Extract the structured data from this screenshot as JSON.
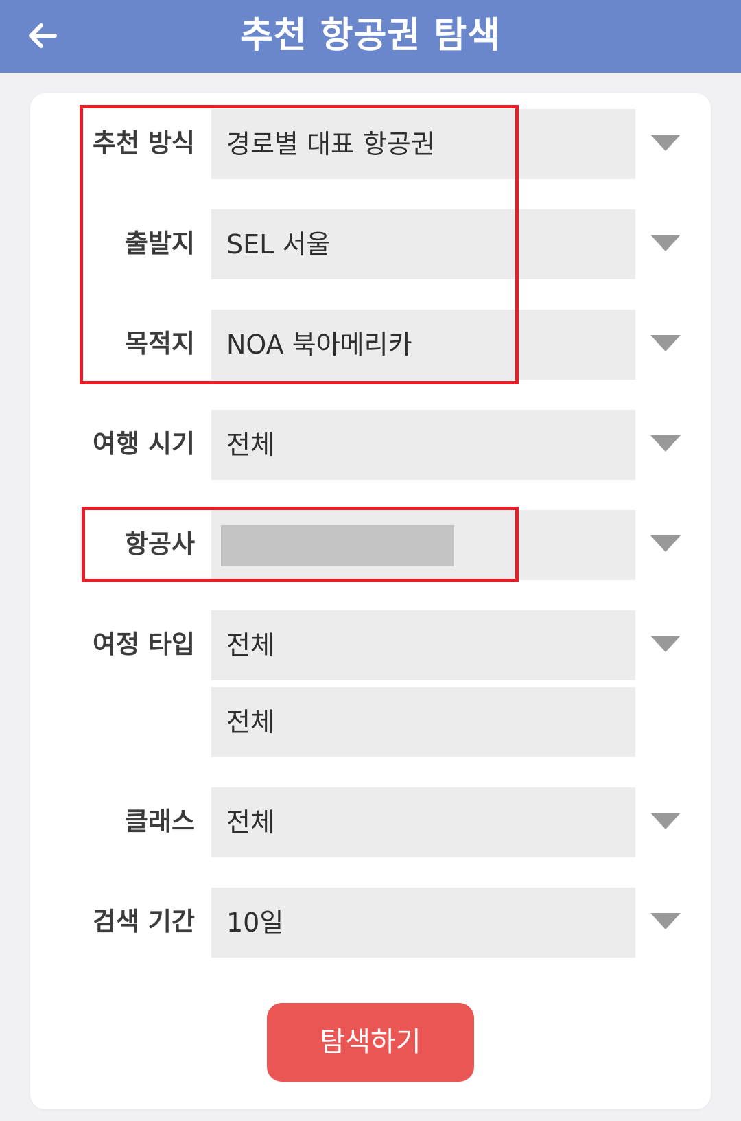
{
  "header": {
    "title": "추천 항공권 탐색",
    "back_icon": "arrow-left-icon"
  },
  "form": {
    "recommend_method": {
      "label": "추천 방식",
      "value": "경로별 대표 항공권"
    },
    "origin": {
      "label": "출발지",
      "value": "SEL 서울"
    },
    "destination": {
      "label": "목적지",
      "value": "NOA 북아메리카"
    },
    "travel_period": {
      "label": "여행 시기",
      "value": "전체"
    },
    "airline": {
      "label": "항공사",
      "value": ""
    },
    "itinerary_type": {
      "label": "여정 타입",
      "value": "전체",
      "value2": "전체"
    },
    "cabin_class": {
      "label": "클래스",
      "value": "전체"
    },
    "search_period": {
      "label": "검색 기간",
      "value": "10일"
    }
  },
  "search_button": {
    "label": "탐색하기"
  },
  "colors": {
    "header_bg": "#6b87cb",
    "field_bg": "#ececec",
    "button_bg": "#e95654",
    "highlight": "#e51e28",
    "caret": "#999999"
  },
  "icons": {
    "dropdown": "caret-down-icon"
  }
}
